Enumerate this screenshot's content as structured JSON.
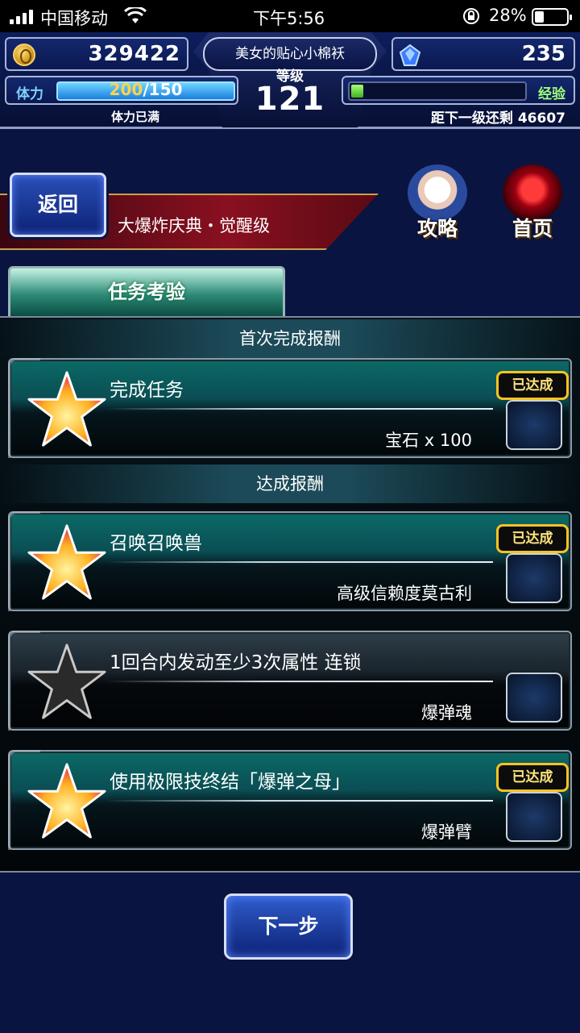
{
  "status_bar": {
    "carrier": "中国移动",
    "time": "下午5:56",
    "battery": "28%",
    "battery_level": 0.28
  },
  "hud": {
    "gil": "329422",
    "gems": "235",
    "player_name": "美女的贴心小棉袄",
    "level_label": "等级",
    "level": "121",
    "stamina_label": "体力",
    "stamina_current": "200",
    "stamina_max": "/150",
    "stamina_status": "体力已满",
    "exp_label": "经验",
    "exp_remaining_label": "距下一级还剩",
    "exp_remaining": "46607",
    "exp_fill": 0.07
  },
  "nav": {
    "back_label": "返回",
    "event_title": "大爆炸庆典・觉醒级",
    "guide_label": "攻略",
    "home_label": "首页"
  },
  "tab": {
    "label": "任务考验"
  },
  "sections": {
    "first_clear": "首次完成报酬",
    "achievement": "达成报酬"
  },
  "missions": [
    {
      "title": "完成任务",
      "reward": "宝石 x 100",
      "completed": true,
      "badge": "已达成",
      "item_icon": "gem-icon"
    },
    {
      "title": "召唤召唤兽",
      "reward": "高级信赖度莫古利",
      "completed": true,
      "badge": "已达成",
      "item_icon": "moogle-icon"
    },
    {
      "title": "1回合内发动至少3次属性 连锁",
      "reward": "爆弹魂",
      "completed": false,
      "badge": "",
      "item_icon": "bomb-soul-icon"
    },
    {
      "title": "使用极限技终结「爆弹之母」",
      "reward": "爆弹臂",
      "completed": true,
      "badge": "已达成",
      "item_icon": "bomb-arm-icon"
    }
  ],
  "footer": {
    "next_label": "下一步"
  },
  "colors": {
    "accent_gold": "#f7c320",
    "panel_teal": "#0b6a66",
    "button_blue": "#2f5ccc"
  }
}
